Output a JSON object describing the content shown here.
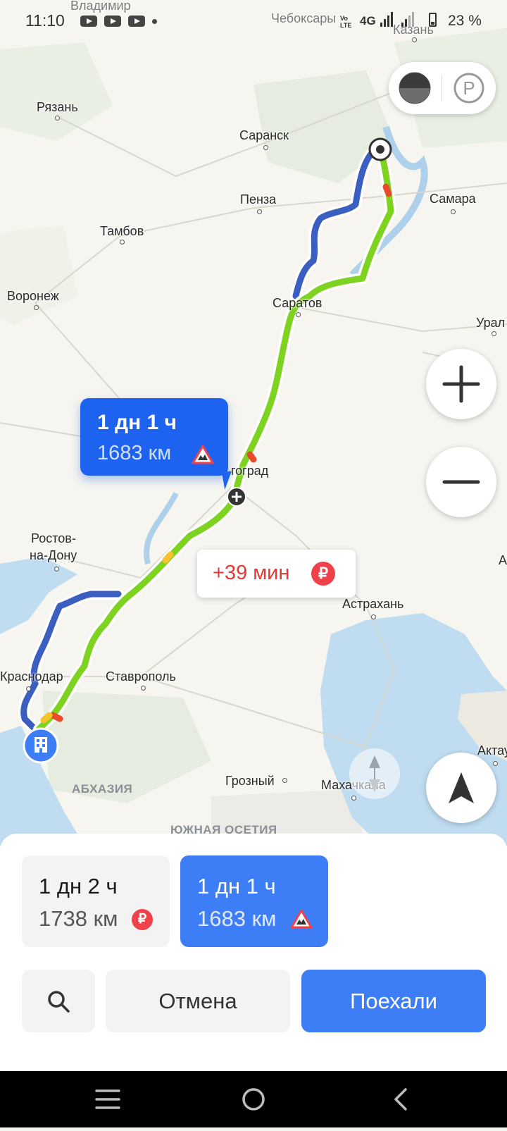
{
  "status_bar": {
    "time": "11:10",
    "network": "4G",
    "battery": "23 %"
  },
  "map": {
    "cities": [
      {
        "name": "Владимир"
      },
      {
        "name": "Чебоксары"
      },
      {
        "name": "Казань"
      },
      {
        "name": "Рязань"
      },
      {
        "name": "Саранск"
      },
      {
        "name": "Пенза"
      },
      {
        "name": "Самара"
      },
      {
        "name": "Тамбов"
      },
      {
        "name": "Воронеж"
      },
      {
        "name": "Саратов"
      },
      {
        "name": "Урал"
      },
      {
        "name": "гоград"
      },
      {
        "name": "Ростов-"
      },
      {
        "name": "на-Дону"
      },
      {
        "name": "Астрахань"
      },
      {
        "name": "Краснодар"
      },
      {
        "name": "Ставрополь"
      },
      {
        "name": "Грозный"
      },
      {
        "name": "Махачкала"
      },
      {
        "name": "Актау"
      },
      {
        "name": "А"
      }
    ],
    "regions": [
      "АБХАЗИЯ",
      "ЮЖНАЯ ОСЕТИЯ"
    ]
  },
  "route_bubble": {
    "time": "1 дн 1 ч",
    "distance": "1683 км"
  },
  "delay_bubble": {
    "text": "+39 мин",
    "toll_symbol": "₽"
  },
  "route_options": [
    {
      "time": "1 дн 2 ч",
      "distance": "1738 км",
      "badge": "₽",
      "selected": false
    },
    {
      "time": "1 дн 1 ч",
      "distance": "1683 км",
      "badge": "rough-road-icon",
      "selected": true
    }
  ],
  "actions": {
    "cancel_label": "Отмена",
    "go_label": "Поехали"
  },
  "colors": {
    "accent": "#3d7df5",
    "route_main": "#7ed321",
    "route_alt": "#3b5fc0",
    "toll": "#f0414a"
  }
}
